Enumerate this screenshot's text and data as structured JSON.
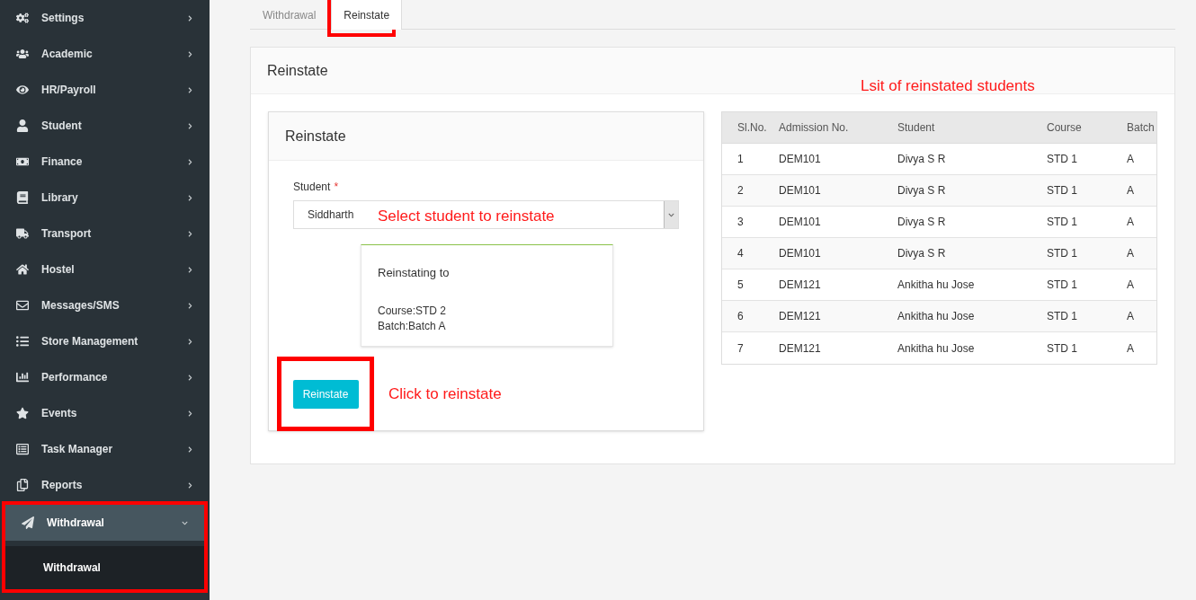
{
  "sidebar": {
    "items": [
      {
        "label": "Settings",
        "expanded": false,
        "highlighted": false
      },
      {
        "label": "Academic",
        "expanded": false,
        "highlighted": false
      },
      {
        "label": "HR/Payroll",
        "expanded": false,
        "highlighted": false
      },
      {
        "label": "Student",
        "expanded": false,
        "highlighted": false
      },
      {
        "label": "Finance",
        "expanded": false,
        "highlighted": false
      },
      {
        "label": "Library",
        "expanded": false,
        "highlighted": false
      },
      {
        "label": "Transport",
        "expanded": false,
        "highlighted": false
      },
      {
        "label": "Hostel",
        "expanded": false,
        "highlighted": false
      },
      {
        "label": "Messages/SMS",
        "expanded": false,
        "highlighted": false
      },
      {
        "label": "Store Management",
        "expanded": false,
        "highlighted": false
      },
      {
        "label": "Performance",
        "expanded": false,
        "highlighted": false
      },
      {
        "label": "Events",
        "expanded": false,
        "highlighted": false
      },
      {
        "label": "Task Manager",
        "expanded": false,
        "highlighted": false
      },
      {
        "label": "Reports",
        "expanded": false,
        "highlighted": false
      },
      {
        "label": "Withdrawal",
        "expanded": true,
        "highlighted": true,
        "children": [
          {
            "label": "Withdrawal"
          }
        ]
      }
    ]
  },
  "tabs": [
    {
      "label": "Withdrawal",
      "selected": false,
      "highlighted": false
    },
    {
      "label": "Reinstate",
      "selected": true,
      "highlighted": true
    }
  ],
  "panel": {
    "title": "Reinstate",
    "annotation": "Lsit of reinstated students",
    "form": {
      "title": "Reinstate",
      "student_label": "Student",
      "required_mark": "*",
      "student_value": "Siddharth",
      "annotation": "Select student to reinstate",
      "info": {
        "heading": "Reinstating to",
        "lines": [
          "Course:STD 2",
          "Batch:Batch A"
        ]
      },
      "button": {
        "label": "Reinstate",
        "highlighted": true
      },
      "button_annotation": "Click to reinstate"
    },
    "table": {
      "columns": [
        "Sl.No.",
        "Admission No.",
        "Student",
        "Course",
        "Batch"
      ],
      "rows": [
        [
          "1",
          "DEM101",
          "Divya S R",
          "STD 1",
          "A"
        ],
        [
          "2",
          "DEM101",
          "Divya S R",
          "STD 1",
          "A"
        ],
        [
          "3",
          "DEM101",
          "Divya S R",
          "STD 1",
          "A"
        ],
        [
          "4",
          "DEM101",
          "Divya S R",
          "STD 1",
          "A"
        ],
        [
          "5",
          "DEM121",
          "Ankitha hu Jose",
          "STD 1",
          "A"
        ],
        [
          "6",
          "DEM121",
          "Ankitha hu Jose",
          "STD 1",
          "A"
        ],
        [
          "7",
          "DEM121",
          "Ankitha hu Jose",
          "STD 1",
          "A"
        ]
      ]
    }
  }
}
